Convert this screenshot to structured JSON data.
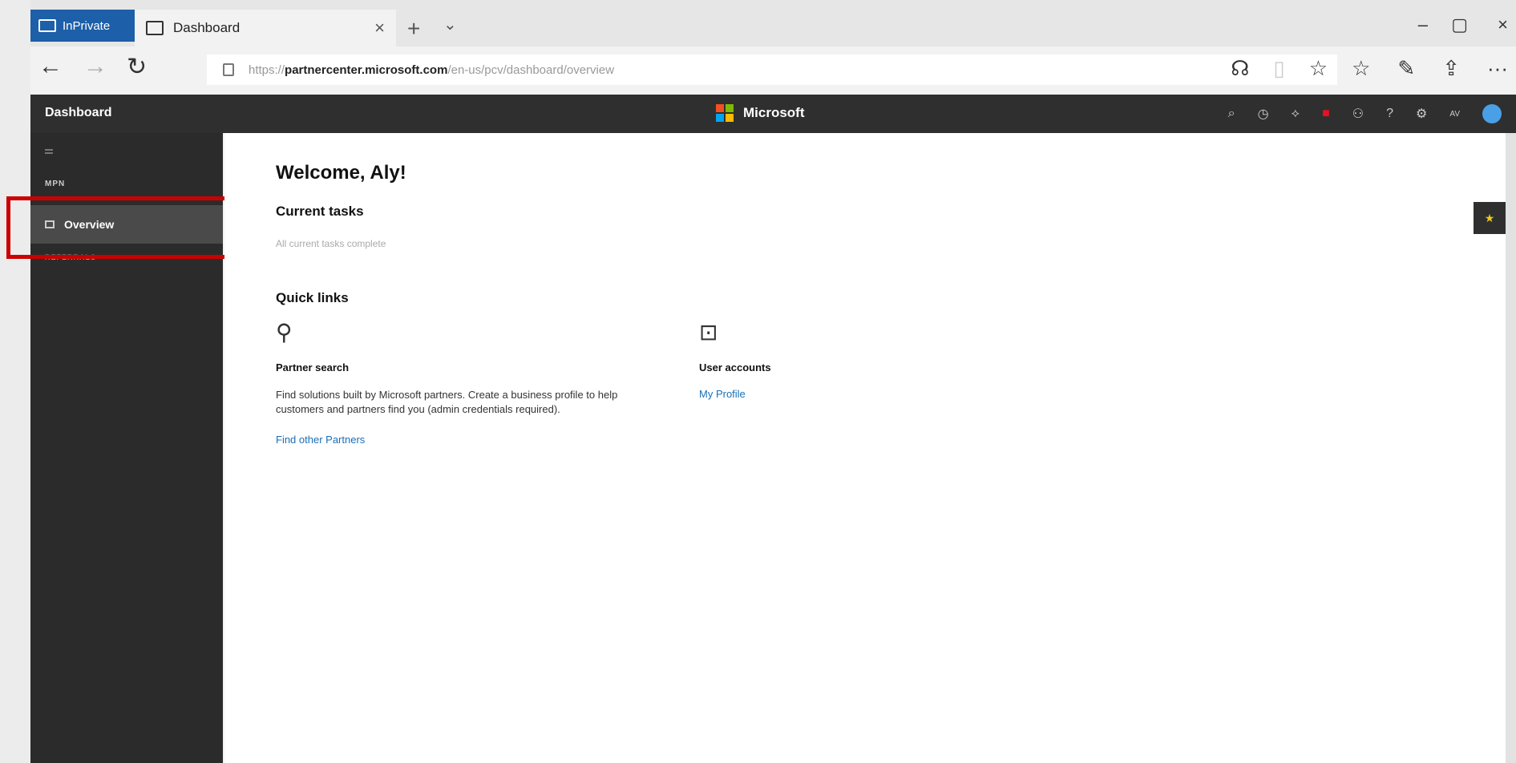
{
  "browser": {
    "inprivate_label": "InPrivate",
    "tab_title": "Dashboard",
    "tab_close": "×",
    "new_tab": "+",
    "tab_list": "⌄",
    "url_scheme": "https://",
    "url_host": "partnercenter.microsoft.com",
    "url_path": "/en-us/pcv/dashboard/overview",
    "minimize": "–",
    "maximize": "▢",
    "close": "×",
    "back": "←",
    "forward": "→",
    "refresh": "↻",
    "more": "···"
  },
  "app": {
    "header_title": "Dashboard",
    "brand": "Microsoft"
  },
  "sidebar": {
    "section_mpn": "MPN",
    "item_overview": "Overview",
    "section_referrals": "REFERRALS"
  },
  "main": {
    "welcome": "Welcome, Aly!",
    "current_tasks_heading": "Current tasks",
    "current_tasks_status": "All current tasks complete",
    "quick_links_heading": "Quick links",
    "partner_search_title": "Partner search",
    "partner_search_desc": "Find solutions built by Microsoft partners. Create a business profile to help customers and partners find you (admin credentials required).",
    "partner_search_link": "Find other Partners",
    "user_accounts_title": "User accounts",
    "user_accounts_link": "My Profile"
  },
  "user": {
    "initials": "AV"
  },
  "colors": {
    "header_bg": "#2f2f2f",
    "sidebar_bg": "#2b2b2b",
    "link": "#1a6fb8",
    "inprivate": "#1d5fa8",
    "highlight": "#cc0000"
  }
}
